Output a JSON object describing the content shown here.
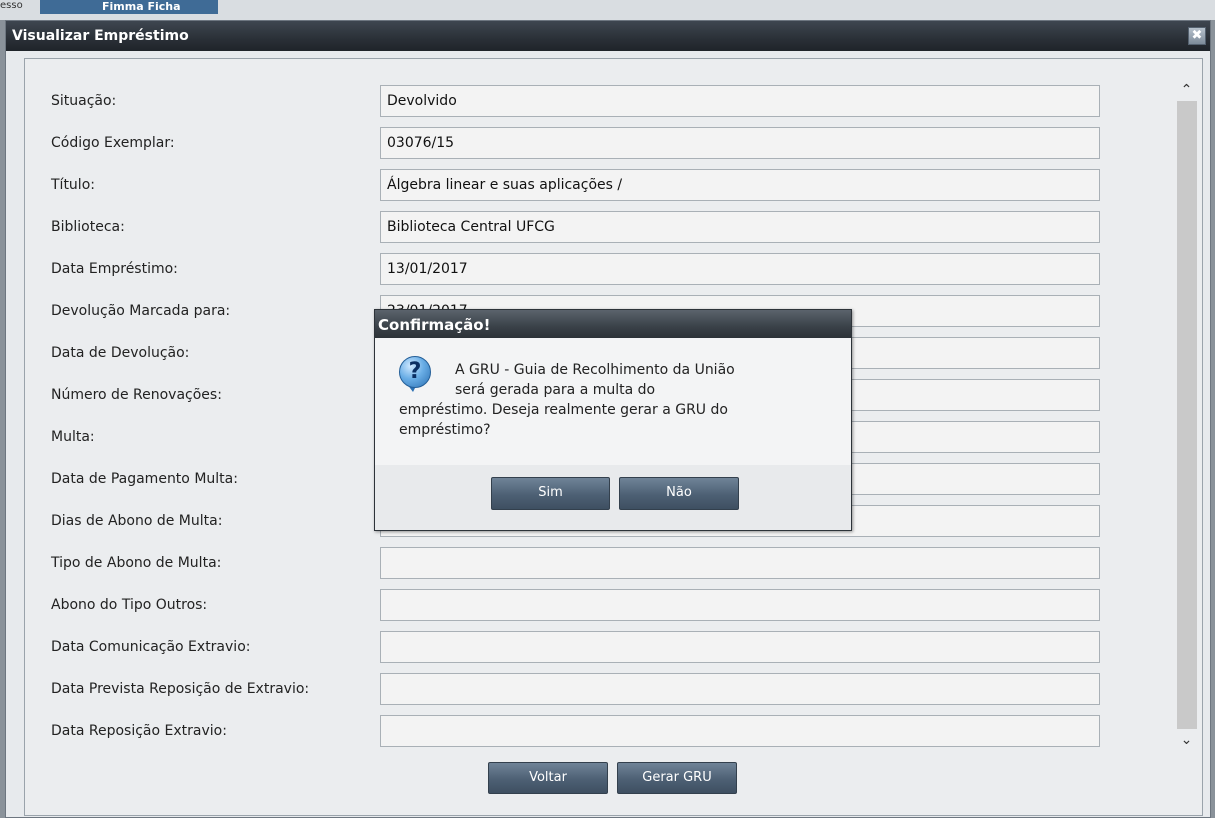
{
  "background": {
    "tab_prefix": "esso",
    "tab_label": "Fimma Ficha"
  },
  "window": {
    "title": "Visualizar Empréstimo",
    "close_icon": "close-icon",
    "close_symbol": "✖"
  },
  "fields": [
    {
      "label": "Situação:",
      "value": "Devolvido"
    },
    {
      "label": "Código Exemplar:",
      "value": "03076/15"
    },
    {
      "label": "Título:",
      "value": "Álgebra linear e suas aplicações /"
    },
    {
      "label": "Biblioteca:",
      "value": "Biblioteca Central UFCG"
    },
    {
      "label": "Data Empréstimo:",
      "value": "13/01/2017"
    },
    {
      "label": "Devolução Marcada para:",
      "value": "23/01/2017"
    },
    {
      "label": "Data de Devolução:",
      "value": ""
    },
    {
      "label": "Número de Renovações:",
      "value": ""
    },
    {
      "label": "Multa:",
      "value": ""
    },
    {
      "label": "Data de Pagamento Multa:",
      "value": ""
    },
    {
      "label": "Dias de Abono de Multa:",
      "value": ""
    },
    {
      "label": "Tipo de Abono de Multa:",
      "value": ""
    },
    {
      "label": "Abono do Tipo Outros:",
      "value": ""
    },
    {
      "label": "Data Comunicação Extravio:",
      "value": ""
    },
    {
      "label": "Data Prevista Reposição de Extravio:",
      "value": ""
    },
    {
      "label": "Data Reposição Extravio:",
      "value": ""
    }
  ],
  "buttons": {
    "voltar": "Voltar",
    "gerar_gru": "Gerar GRU"
  },
  "scrollbar": {
    "up_symbol": "⌃",
    "down_symbol": "⌄"
  },
  "dialog": {
    "title": "Confirmação!",
    "icon": "question-icon",
    "icon_symbol": "?",
    "message_line1": "A GRU - Guia de Recolhimento da União",
    "message_line2": "será gerada para a multa do",
    "message_line3": "empréstimo. Deseja realmente gerar a GRU do",
    "message_line4": "empréstimo?",
    "yes": "Sim",
    "no": "Não"
  },
  "colors": {
    "titlebar": "#2a3037",
    "button": "#4d6074",
    "background": "#ebedef"
  }
}
